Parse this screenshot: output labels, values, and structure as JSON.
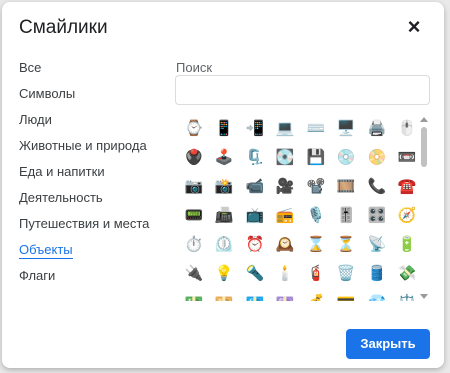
{
  "dialog": {
    "title": "Смайлики",
    "close_icon": "×",
    "close_button": "Закрыть"
  },
  "categories": [
    {
      "label": "Все",
      "active": false
    },
    {
      "label": "Символы",
      "active": false
    },
    {
      "label": "Люди",
      "active": false
    },
    {
      "label": "Животные и природа",
      "active": false
    },
    {
      "label": "Еда и напитки",
      "active": false
    },
    {
      "label": "Деятельность",
      "active": false
    },
    {
      "label": "Путешествия и места",
      "active": false
    },
    {
      "label": "Объекты",
      "active": true
    },
    {
      "label": "Флаги",
      "active": false
    }
  ],
  "search": {
    "label": "Поиск",
    "value": "",
    "placeholder": ""
  },
  "emoji_rows": [
    [
      "⌚",
      "📱",
      "📲",
      "💻",
      "⌨️",
      "🖥️",
      "🖨️",
      "🖱️"
    ],
    [
      "🖲️",
      "🕹️",
      "🗜️",
      "💽",
      "💾",
      "💿",
      "📀",
      "📼"
    ],
    [
      "📷",
      "📸",
      "📹",
      "🎥",
      "📽️",
      "🎞️",
      "📞",
      "☎️"
    ],
    [
      "📟",
      "📠",
      "📺",
      "📻",
      "🎙️",
      "🎚️",
      "🎛️",
      "🧭"
    ],
    [
      "⏱️",
      "⏲️",
      "⏰",
      "🕰️",
      "⌛",
      "⏳",
      "📡",
      "🔋"
    ],
    [
      "🔌",
      "💡",
      "🔦",
      "🕯️",
      "🧯",
      "🗑️",
      "🛢️",
      "💸"
    ],
    [
      "💵",
      "💴",
      "💶",
      "💷",
      "💰",
      "💳",
      "💎",
      "⚖️"
    ]
  ],
  "scrollbar": {
    "up_icon": "arrow-up",
    "down_icon": "arrow-down"
  }
}
